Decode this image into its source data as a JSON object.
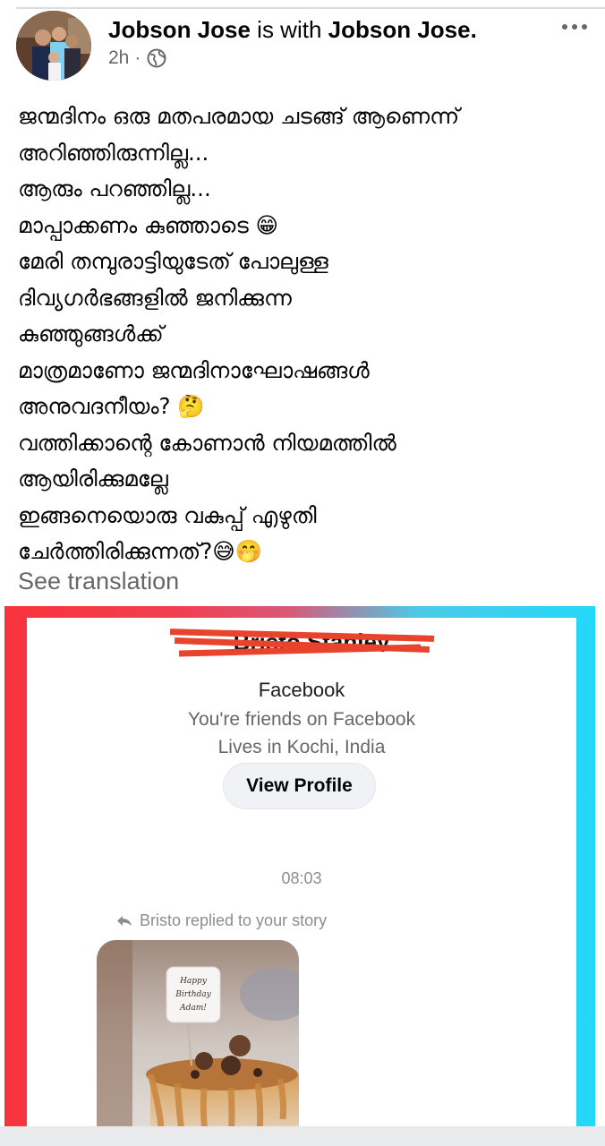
{
  "post": {
    "author": "Jobson Jose",
    "with_text": "is with",
    "tagged": "Jobson Jose.",
    "time": "2h",
    "privacy_icon": "globe-icon",
    "more_icon": "more-options-icon",
    "lines": [
      "ജന്മദിനം ഒരു മതപരമായ ചടങ്ങ് ആണെന്ന്",
      "അറിഞ്ഞിരുന്നില്ല...",
      "ആരും പറഞ്ഞില്ല...",
      "മാപ്പാക്കണം കുഞ്ഞാടെ 😁",
      "മേരി തമ്പുരാട്ടിയുടേത് പോലുള്ള",
      "ദിവ്യഗർഭങ്ങളിൽ ജനിക്കുന്ന",
      "കുഞ്ഞുങ്ങൾക്ക്",
      "മാത്രമാണോ ജന്മദിനാഘോഷങ്ങൾ",
      "അനുവദനീയം? 🤔",
      "വത്തിക്കാന്റെ കോണാൻ നിയമത്തിൽ",
      "ആയിരിക്കുമല്ലേ",
      "ഇങ്ങനെയൊരു വകുപ്പ് എഴുതി",
      "ചേർത്തിരിക്കുന്നത്?😅🤭"
    ],
    "see_translation": "See translation"
  },
  "screenshot": {
    "redacted_name": "Bristo Stanley",
    "platform": "Facebook",
    "friends_text": "You're friends on Facebook",
    "lives_text": "Lives in Kochi, India",
    "view_profile": "View Profile",
    "time": "08:03",
    "replied_text": "Bristo replied to your story",
    "cake_topper": [
      "Happy",
      "Birthday",
      "Adam!"
    ],
    "colors": {
      "border_left": "#f8333c",
      "border_right": "#23d8f8",
      "strike": "#e8432d"
    }
  }
}
